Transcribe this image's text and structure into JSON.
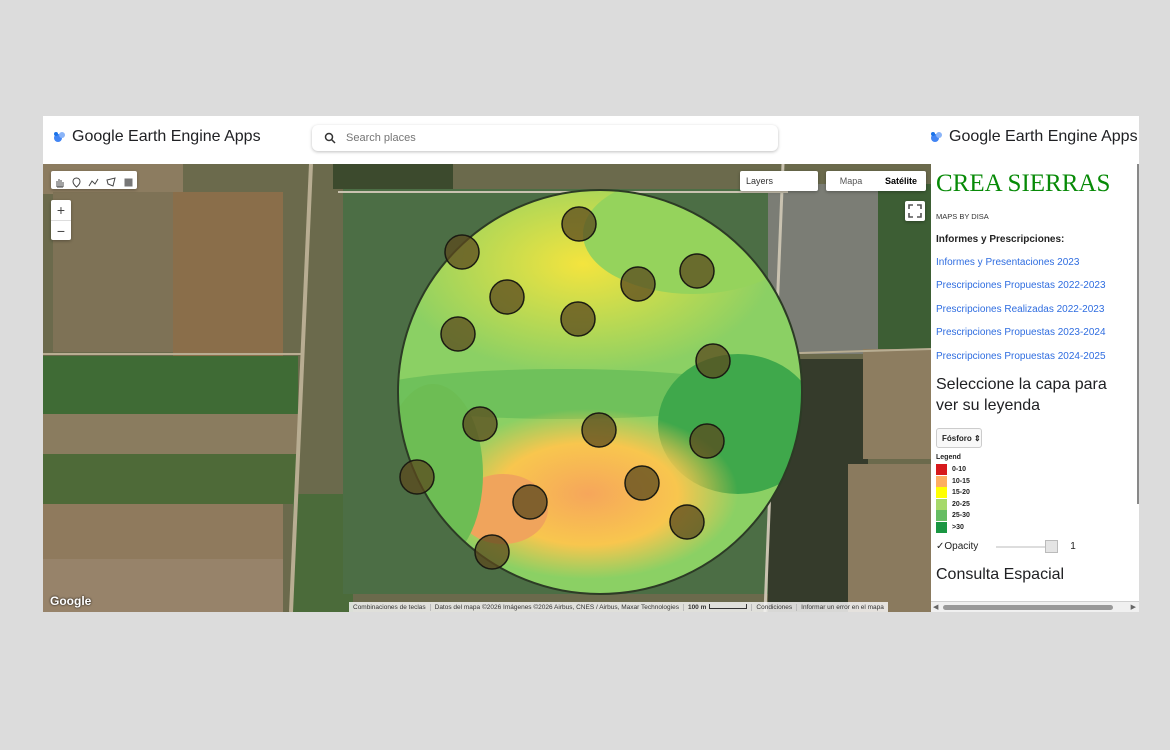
{
  "header": {
    "brand_left": "Google Earth Engine Apps",
    "brand_right": "Google Earth Engine Apps",
    "search_placeholder": "Search places"
  },
  "map": {
    "draw_tools": [
      "hand-icon",
      "marker-icon",
      "polyline-icon",
      "polygon-icon",
      "rectangle-icon"
    ],
    "zoom_in": "+",
    "zoom_out": "−",
    "layers_label": "Layers",
    "map_type_options": [
      "Mapa",
      "Satélite"
    ],
    "map_type_selected": "Satélite",
    "google_logo": "Google",
    "attribution": {
      "shortcuts": "Combinaciones de teclas",
      "data": "Datos del mapa ©2026 Imágenes ©2026 Airbus, CNES / Airbus, Maxar Technologies",
      "scale": "100 m",
      "terms": "Condiciones",
      "report": "Informar un error en el mapa"
    }
  },
  "panel": {
    "title": "CREA SIERRAS",
    "subtitle": "MAPS BY DISA",
    "reports_heading": "Informes y Prescripciones:",
    "links": [
      "Informes y Presentaciones 2023",
      "Prescripciones Propuestas 2022-2023",
      "Prescripciones Realizadas 2022-2023",
      "Prescripciones Propuestas 2023-2024",
      "Prescripciones Propuestas 2024-2025"
    ],
    "layer_prompt": "Seleccione la capa para ver su leyenda",
    "layer_select_value": "Fósforo",
    "legend_title": "Legend",
    "legend": [
      {
        "label": "0-10",
        "color": "#d7191c"
      },
      {
        "label": "10-15",
        "color": "#fdae61"
      },
      {
        "label": "15-20",
        "color": "#ffff00"
      },
      {
        "label": "20-25",
        "color": "#a6d96a"
      },
      {
        "label": "25-30",
        "color": "#66bd63"
      },
      {
        "label": ">30",
        "color": "#1a9641"
      }
    ],
    "opacity_label": "Opacity",
    "opacity_value": "1",
    "consulta_heading": "Consulta Espacial"
  }
}
